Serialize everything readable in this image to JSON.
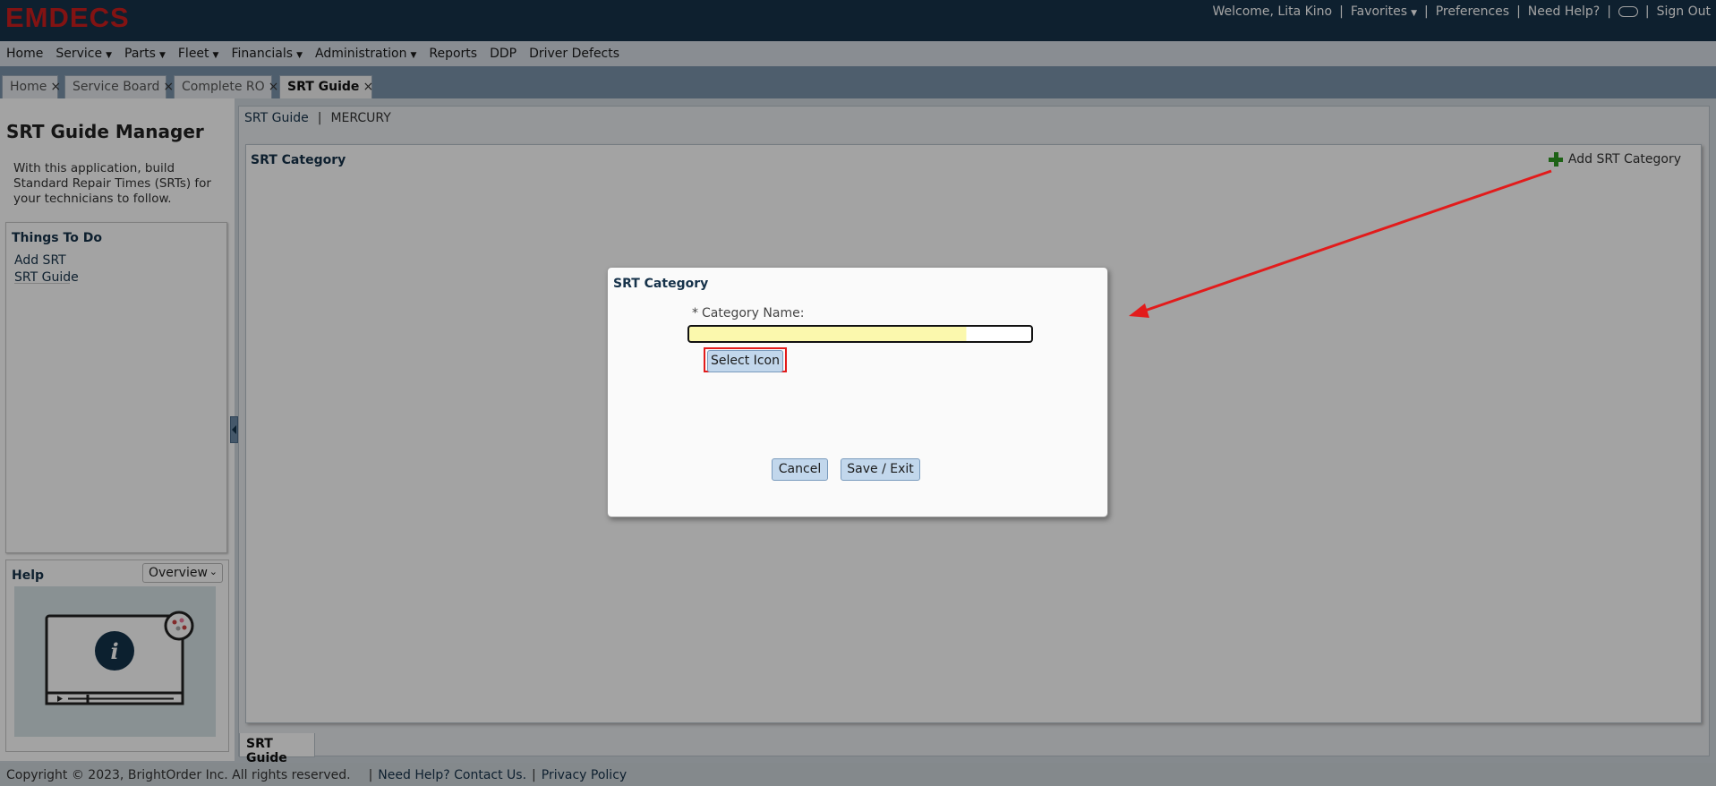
{
  "header": {
    "logo": "EMDECS",
    "welcome": "Welcome, Lita Kino",
    "favorites": "Favorites",
    "preferences": "Preferences",
    "need_help": "Need Help?",
    "sign_out": "Sign Out"
  },
  "menu": [
    "Home",
    "Service",
    "Parts",
    "Fleet",
    "Financials",
    "Administration",
    "Reports",
    "DDP",
    "Driver Defects"
  ],
  "tabs": [
    "Home",
    "Service Board",
    "Complete RO",
    "SRT Guide"
  ],
  "sidebar": {
    "title": "SRT Guide Manager",
    "description": "With this application, build Standard Repair Times (SRTs) for your technicians to follow.",
    "things_to_do_title": "Things To Do",
    "things_to_do": [
      "Add SRT",
      "SRT Guide"
    ],
    "help_title": "Help",
    "help_select": "Overview"
  },
  "breadcrumb": {
    "link": "SRT Guide",
    "current": "MERCURY"
  },
  "panel": {
    "title": "SRT Category",
    "add_label": "Add SRT Category"
  },
  "bottom_tab": "SRT Guide",
  "dialog": {
    "title": "SRT Category",
    "field_label": "Category Name:",
    "required_mark": "*",
    "field_value": "",
    "select_icon": "Select Icon",
    "cancel": "Cancel",
    "save_exit": "Save / Exit"
  },
  "footer": {
    "copyright": "Copyright © 2023, BrightOrder Inc. All rights reserved.",
    "contact": "Need Help? Contact Us.",
    "privacy": "Privacy Policy"
  },
  "colors": {
    "header_bg": "#16324a",
    "logo": "#cc1f1f",
    "link": "#16324a",
    "highlight": "#e21b1b",
    "field_fill": "#fbf8ad"
  }
}
